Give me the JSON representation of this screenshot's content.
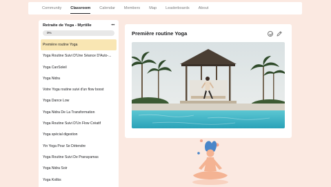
{
  "nav": {
    "tabs": [
      {
        "label": "Community",
        "active": false
      },
      {
        "label": "Classroom",
        "active": true
      },
      {
        "label": "Calendar",
        "active": false
      },
      {
        "label": "Members",
        "active": false
      },
      {
        "label": "Map",
        "active": false
      },
      {
        "label": "Leaderboards",
        "active": false
      },
      {
        "label": "About",
        "active": false
      }
    ]
  },
  "sidebar": {
    "course_title": "Retraite de Yoga - Myrtille",
    "menu_icon": "more-dots-icon",
    "progress": {
      "label": "0%",
      "value": 0
    },
    "lessons": [
      {
        "label": "Première routine Yoga",
        "active": true
      },
      {
        "label": "Yoga Routine Suivi D'Une Séance D'Auto-...",
        "active": false
      },
      {
        "label": "Yoga CanSoleil",
        "active": false
      },
      {
        "label": "Yoga Nidra",
        "active": false
      },
      {
        "label": "Votre Yoga routine suivi d'un flow boost",
        "active": false
      },
      {
        "label": "Yoga Dance Low",
        "active": false
      },
      {
        "label": "Yoga Nidra De La Transformation",
        "active": false
      },
      {
        "label": "Yoga Routine Suivi D'Un Flow Créatif",
        "active": false
      },
      {
        "label": "Yoga spécial digestion",
        "active": false
      },
      {
        "label": "Yin Yoga Pour Se Détendre",
        "active": false
      },
      {
        "label": "Yoga Routine Suivi De Pranayamas",
        "active": false
      },
      {
        "label": "Yoga Nidra Soir",
        "active": false
      },
      {
        "label": "Yoga Kolibs",
        "active": false
      }
    ]
  },
  "main": {
    "title": "Première routine Yoga",
    "icons": [
      "check-circle-icon",
      "edit-pencil-icon"
    ]
  },
  "colors": {
    "background": "#fbe9e1",
    "active_lesson": "#f9e6b3",
    "pool": "#3fb8c9",
    "illustration_hair": "#4a86c9",
    "illustration_body": "#f4b393"
  }
}
